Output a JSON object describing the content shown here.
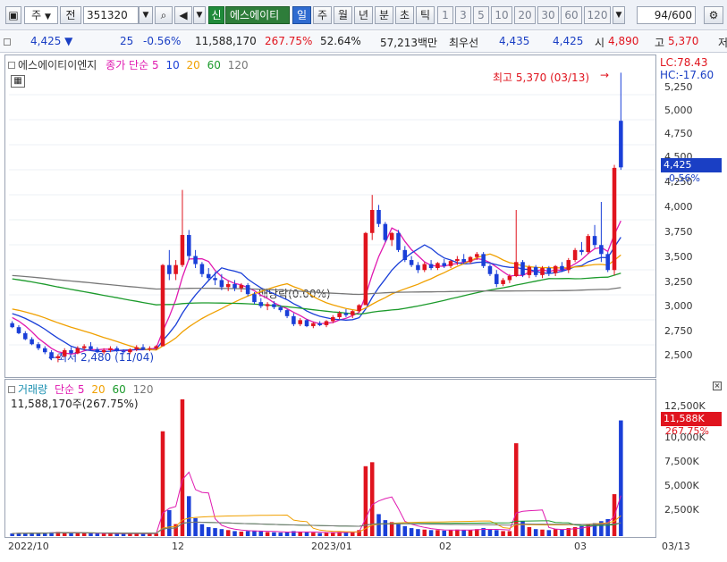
{
  "toolbar": {
    "market": "주",
    "prev_btn": "전",
    "code": "351320",
    "tag": "신",
    "name": "에스에이티",
    "periods": [
      "일",
      "주",
      "월",
      "년",
      "분",
      "초",
      "틱"
    ],
    "minutes": [
      "1",
      "3",
      "5",
      "10",
      "20",
      "30",
      "60",
      "120"
    ],
    "count": "94",
    "count_total": "/600"
  },
  "quote": {
    "price": "4,425 ▼",
    "change": "25",
    "change_pct": "-0.56%",
    "volume": "11,588,170",
    "volume_pct": "267.75%",
    "ratio": "52.64%",
    "amount": "57,213백만",
    "best_bid_label": "최우선",
    "best_ask": "4,435",
    "best_bid": "4,425",
    "open_label": "시",
    "open": "4,890",
    "high_label": "고",
    "high": "5,370",
    "low_label": "저"
  },
  "price_panel": {
    "legend": {
      "name": "에스에이티이엔지",
      "indicator": "종가 단순",
      "periods": [
        "5",
        "10",
        "20",
        "60",
        "120"
      ],
      "colors": [
        "#e01ab0",
        "#1a3fd8",
        "#f0a000",
        "#1b9a2b",
        "#777777"
      ]
    },
    "high_note": "최고 5,370 (03/13)",
    "low_note": "최저 2,480 (11/04)",
    "dividend_note": "배당락(0.00%)",
    "lc": "LC:78.43",
    "hc": "HC:-17.60",
    "current_price": "4,425",
    "current_pct": "-0.56%",
    "y_ticks": [
      "5,250",
      "5,000",
      "4,750",
      "4,500",
      "4,250",
      "4,000",
      "3,750",
      "3,500",
      "3,250",
      "3,000",
      "2,750",
      "2,500"
    ]
  },
  "volume_panel": {
    "legend_label": "거래량",
    "indicator": "단순",
    "periods": [
      "5",
      "20",
      "60",
      "120"
    ],
    "colors": [
      "#e01ab0",
      "#f0a000",
      "#1b9a2b",
      "#777777"
    ],
    "value_text": "11,588,170주(267.75%)",
    "current": "11,588K",
    "current_pct": "267.75%",
    "y_ticks": [
      "12,500K",
      "10,000K",
      "7,500K",
      "5,000K",
      "2,500K"
    ]
  },
  "x_axis": [
    "2022/10",
    "12",
    "2023/01",
    "02",
    "03",
    "03/13"
  ],
  "chart_data": {
    "type": "candlestick",
    "ylim": [
      2350,
      5400
    ],
    "volume_ylim": [
      0,
      14500000
    ],
    "candles": [
      [
        2870,
        2890,
        2820,
        2830,
        260000
      ],
      [
        2830,
        2850,
        2760,
        2770,
        300000
      ],
      [
        2770,
        2790,
        2700,
        2710,
        280000
      ],
      [
        2710,
        2730,
        2650,
        2660,
        320000
      ],
      [
        2660,
        2680,
        2600,
        2620,
        300000
      ],
      [
        2620,
        2640,
        2560,
        2580,
        350000
      ],
      [
        2580,
        2600,
        2500,
        2520,
        380000
      ],
      [
        2520,
        2560,
        2480,
        2540,
        420000
      ],
      [
        2540,
        2620,
        2530,
        2600,
        350000
      ],
      [
        2600,
        2630,
        2560,
        2570,
        280000
      ],
      [
        2570,
        2640,
        2560,
        2620,
        300000
      ],
      [
        2620,
        2660,
        2600,
        2640,
        320000
      ],
      [
        2640,
        2680,
        2600,
        2610,
        280000
      ],
      [
        2610,
        2630,
        2570,
        2580,
        260000
      ],
      [
        2580,
        2620,
        2560,
        2600,
        240000
      ],
      [
        2600,
        2640,
        2580,
        2620,
        250000
      ],
      [
        2620,
        2640,
        2580,
        2590,
        230000
      ],
      [
        2590,
        2610,
        2560,
        2580,
        240000
      ],
      [
        2580,
        2620,
        2560,
        2610,
        250000
      ],
      [
        2610,
        2650,
        2590,
        2630,
        260000
      ],
      [
        2630,
        2660,
        2600,
        2610,
        240000
      ],
      [
        2610,
        2640,
        2590,
        2620,
        250000
      ],
      [
        2620,
        2650,
        2600,
        2640,
        270000
      ],
      [
        2640,
        3460,
        2640,
        3450,
        10500000
      ],
      [
        3450,
        3600,
        3300,
        3360,
        2600000
      ],
      [
        3360,
        3500,
        3300,
        3450,
        1200000
      ],
      [
        3450,
        4200,
        3430,
        3750,
        13700000
      ],
      [
        3750,
        3800,
        3500,
        3540,
        4000000
      ],
      [
        3540,
        3600,
        3420,
        3460,
        1800000
      ],
      [
        3460,
        3480,
        3330,
        3360,
        1200000
      ],
      [
        3360,
        3420,
        3300,
        3320,
        900000
      ],
      [
        3320,
        3380,
        3250,
        3300,
        800000
      ],
      [
        3300,
        3360,
        3200,
        3230,
        700000
      ],
      [
        3230,
        3290,
        3190,
        3260,
        600000
      ],
      [
        3260,
        3300,
        3190,
        3220,
        500000
      ],
      [
        3220,
        3270,
        3180,
        3250,
        450000
      ],
      [
        3250,
        3270,
        3140,
        3160,
        500000
      ],
      [
        3160,
        3180,
        3060,
        3080,
        550000
      ],
      [
        3080,
        3120,
        3020,
        3040,
        500000
      ],
      [
        3040,
        3080,
        3000,
        3060,
        400000
      ],
      [
        3060,
        3090,
        3010,
        3030,
        380000
      ],
      [
        3030,
        3050,
        2980,
        3000,
        350000
      ],
      [
        3000,
        3010,
        2920,
        2940,
        400000
      ],
      [
        2940,
        2970,
        2840,
        2860,
        500000
      ],
      [
        2860,
        2920,
        2840,
        2900,
        450000
      ],
      [
        2900,
        2910,
        2830,
        2840,
        380000
      ],
      [
        2840,
        2880,
        2820,
        2870,
        350000
      ],
      [
        2870,
        2890,
        2840,
        2850,
        300000
      ],
      [
        2850,
        2900,
        2830,
        2890,
        330000
      ],
      [
        2890,
        2950,
        2870,
        2930,
        380000
      ],
      [
        2930,
        2990,
        2910,
        2970,
        420000
      ],
      [
        2970,
        3010,
        2930,
        2950,
        360000
      ],
      [
        2950,
        3000,
        2920,
        2990,
        380000
      ],
      [
        2990,
        3060,
        2980,
        3050,
        600000
      ],
      [
        3050,
        3780,
        3050,
        3770,
        7000000
      ],
      [
        3770,
        4150,
        3700,
        4000,
        7400000
      ],
      [
        4000,
        4050,
        3830,
        3860,
        2200000
      ],
      [
        3860,
        3880,
        3680,
        3700,
        1600000
      ],
      [
        3700,
        3780,
        3640,
        3770,
        1400000
      ],
      [
        3770,
        3800,
        3580,
        3600,
        1200000
      ],
      [
        3600,
        3640,
        3480,
        3500,
        1000000
      ],
      [
        3500,
        3540,
        3430,
        3450,
        800000
      ],
      [
        3450,
        3480,
        3370,
        3400,
        700000
      ],
      [
        3400,
        3480,
        3380,
        3460,
        650000
      ],
      [
        3460,
        3500,
        3400,
        3420,
        600000
      ],
      [
        3420,
        3480,
        3400,
        3470,
        600000
      ],
      [
        3470,
        3510,
        3420,
        3440,
        550000
      ],
      [
        3440,
        3500,
        3420,
        3490,
        600000
      ],
      [
        3490,
        3540,
        3450,
        3510,
        650000
      ],
      [
        3510,
        3560,
        3460,
        3480,
        600000
      ],
      [
        3480,
        3540,
        3460,
        3530,
        620000
      ],
      [
        3530,
        3580,
        3500,
        3560,
        700000
      ],
      [
        3560,
        3580,
        3420,
        3440,
        800000
      ],
      [
        3440,
        3460,
        3340,
        3360,
        650000
      ],
      [
        3360,
        3400,
        3230,
        3260,
        600000
      ],
      [
        3260,
        3320,
        3240,
        3300,
        500000
      ],
      [
        3300,
        3360,
        3270,
        3340,
        500000
      ],
      [
        3340,
        4000,
        3330,
        3480,
        9300000
      ],
      [
        3480,
        3500,
        3330,
        3350,
        1500000
      ],
      [
        3350,
        3450,
        3320,
        3430,
        900000
      ],
      [
        3430,
        3450,
        3330,
        3350,
        700000
      ],
      [
        3350,
        3440,
        3320,
        3420,
        650000
      ],
      [
        3420,
        3440,
        3340,
        3370,
        600000
      ],
      [
        3370,
        3450,
        3340,
        3440,
        700000
      ],
      [
        3440,
        3480,
        3380,
        3400,
        650000
      ],
      [
        3400,
        3520,
        3370,
        3500,
        800000
      ],
      [
        3500,
        3620,
        3480,
        3600,
        900000
      ],
      [
        3600,
        3680,
        3550,
        3580,
        1000000
      ],
      [
        3580,
        3760,
        3560,
        3740,
        1200000
      ],
      [
        3740,
        3850,
        3620,
        3650,
        1300000
      ],
      [
        3650,
        4080,
        3480,
        3560,
        1500000
      ],
      [
        3560,
        3580,
        3380,
        3400,
        1700000
      ],
      [
        3400,
        4450,
        3350,
        4420,
        4200000
      ],
      [
        4890,
        5370,
        4400,
        4425,
        11588170
      ]
    ]
  }
}
